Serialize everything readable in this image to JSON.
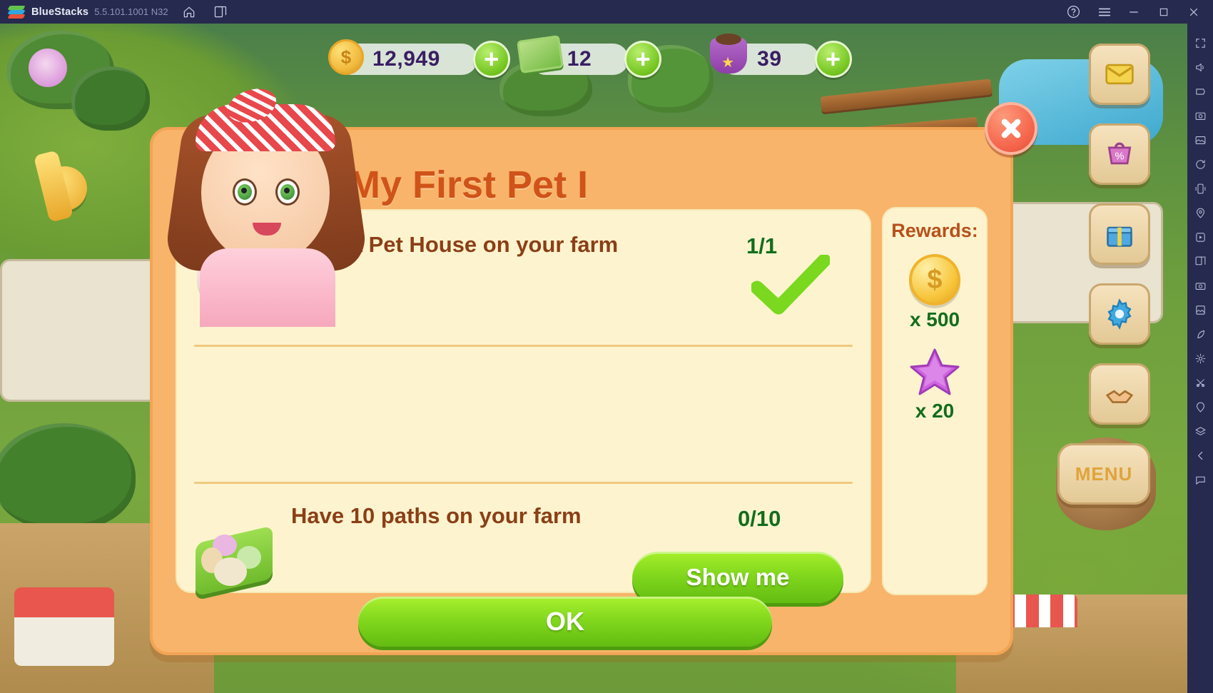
{
  "titlebar": {
    "app_name": "BlueStacks",
    "version": "5.5.101.1001 N32",
    "home_icon": "home-icon",
    "instances_icon": "multi-instance-icon",
    "help_icon": "help-icon",
    "menu_icon": "hamburger-menu-icon",
    "minimize_icon": "minimize-icon",
    "maximize_icon": "maximize-icon",
    "close_icon": "close-window-icon"
  },
  "hud": {
    "coins": {
      "icon": "gold-coin-icon",
      "value": "12,949",
      "add_label": "+"
    },
    "cash": {
      "icon": "cash-stack-icon",
      "value": "12",
      "add_label": "+"
    },
    "stars": {
      "icon": "star-bag-icon",
      "value": "39",
      "add_label": "+"
    }
  },
  "dialog": {
    "title": "My First Pet I",
    "close_label": "✕",
    "ok_label": "OK",
    "avatar_name": "farm-girl-avatar",
    "tasks": [
      {
        "icon": "pet-house-icon",
        "label": "Have a Pet House on your farm",
        "count": "1/1",
        "complete": true,
        "check_icon": "green-checkmark-icon"
      },
      {
        "icon": "path-tile-icon",
        "label": "Have 10 paths on your farm",
        "count": "0/10",
        "complete": false,
        "action_label": "Show me"
      }
    ],
    "rewards": {
      "title": "Rewards:",
      "items": [
        {
          "icon": "gold-coin-icon",
          "amount": "x 500"
        },
        {
          "icon": "purple-star-icon",
          "amount": "x 20"
        }
      ]
    }
  },
  "sidebar": {
    "items": [
      "fullscreen-icon",
      "volume-icon",
      "keyboard-mapping-icon",
      "screenshot-icon",
      "media-manager-icon",
      "rotate-icon",
      "shake-icon",
      "location-icon",
      "macro-icon",
      "multi-instance-sync-icon",
      "camera-icon",
      "gallery-icon",
      "eco-mode-icon",
      "settings-icon",
      "trim-icon",
      "pin-icon",
      "layers-icon",
      "back-icon",
      "chat-icon"
    ]
  },
  "colors": {
    "dialog_bg": "#f8b46a",
    "card_bg": "#fdf4cf",
    "title_text": "#d0531a",
    "task_text": "#8b3f16",
    "count_text": "#136d1d",
    "green_button": "#82d81d",
    "close_red": "#f4634a",
    "titlebar_bg": "#262a4e"
  }
}
